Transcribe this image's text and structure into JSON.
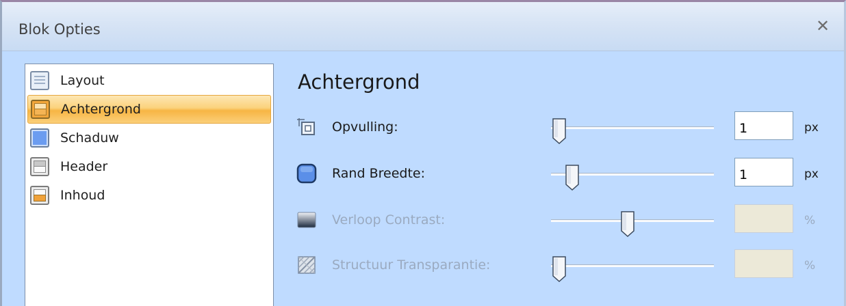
{
  "window": {
    "title": "Blok Opties",
    "close_glyph": "✕"
  },
  "sidebar": {
    "items": [
      {
        "label": "Layout",
        "icon": "layout-icon",
        "selected": false
      },
      {
        "label": "Achtergrond",
        "icon": "background-icon",
        "selected": true
      },
      {
        "label": "Schaduw",
        "icon": "shadow-icon",
        "selected": false
      },
      {
        "label": "Header",
        "icon": "header-icon",
        "selected": false
      },
      {
        "label": "Inhoud",
        "icon": "content-icon",
        "selected": false
      }
    ]
  },
  "main": {
    "section_title": "Achtergrond",
    "rows": [
      {
        "label": "Opvulling:",
        "icon": "padding-icon",
        "slider_fraction": 0.05,
        "value": "1",
        "unit": "px",
        "enabled": true
      },
      {
        "label": "Rand Breedte:",
        "icon": "border-width-icon",
        "slider_fraction": 0.13,
        "value": "1",
        "unit": "px",
        "enabled": true
      },
      {
        "label": "Verloop Contrast:",
        "icon": "gradient-contrast-icon",
        "slider_fraction": 0.47,
        "value": "",
        "unit": "%",
        "enabled": false
      },
      {
        "label": "Structuur Transparantie:",
        "icon": "texture-transparency-icon",
        "slider_fraction": 0.05,
        "value": "",
        "unit": "%",
        "enabled": false
      }
    ]
  },
  "colors": {
    "dialog_bg": "#bfdbff",
    "selected_item": "#f7b544",
    "disabled_text": "#9aaac0"
  }
}
